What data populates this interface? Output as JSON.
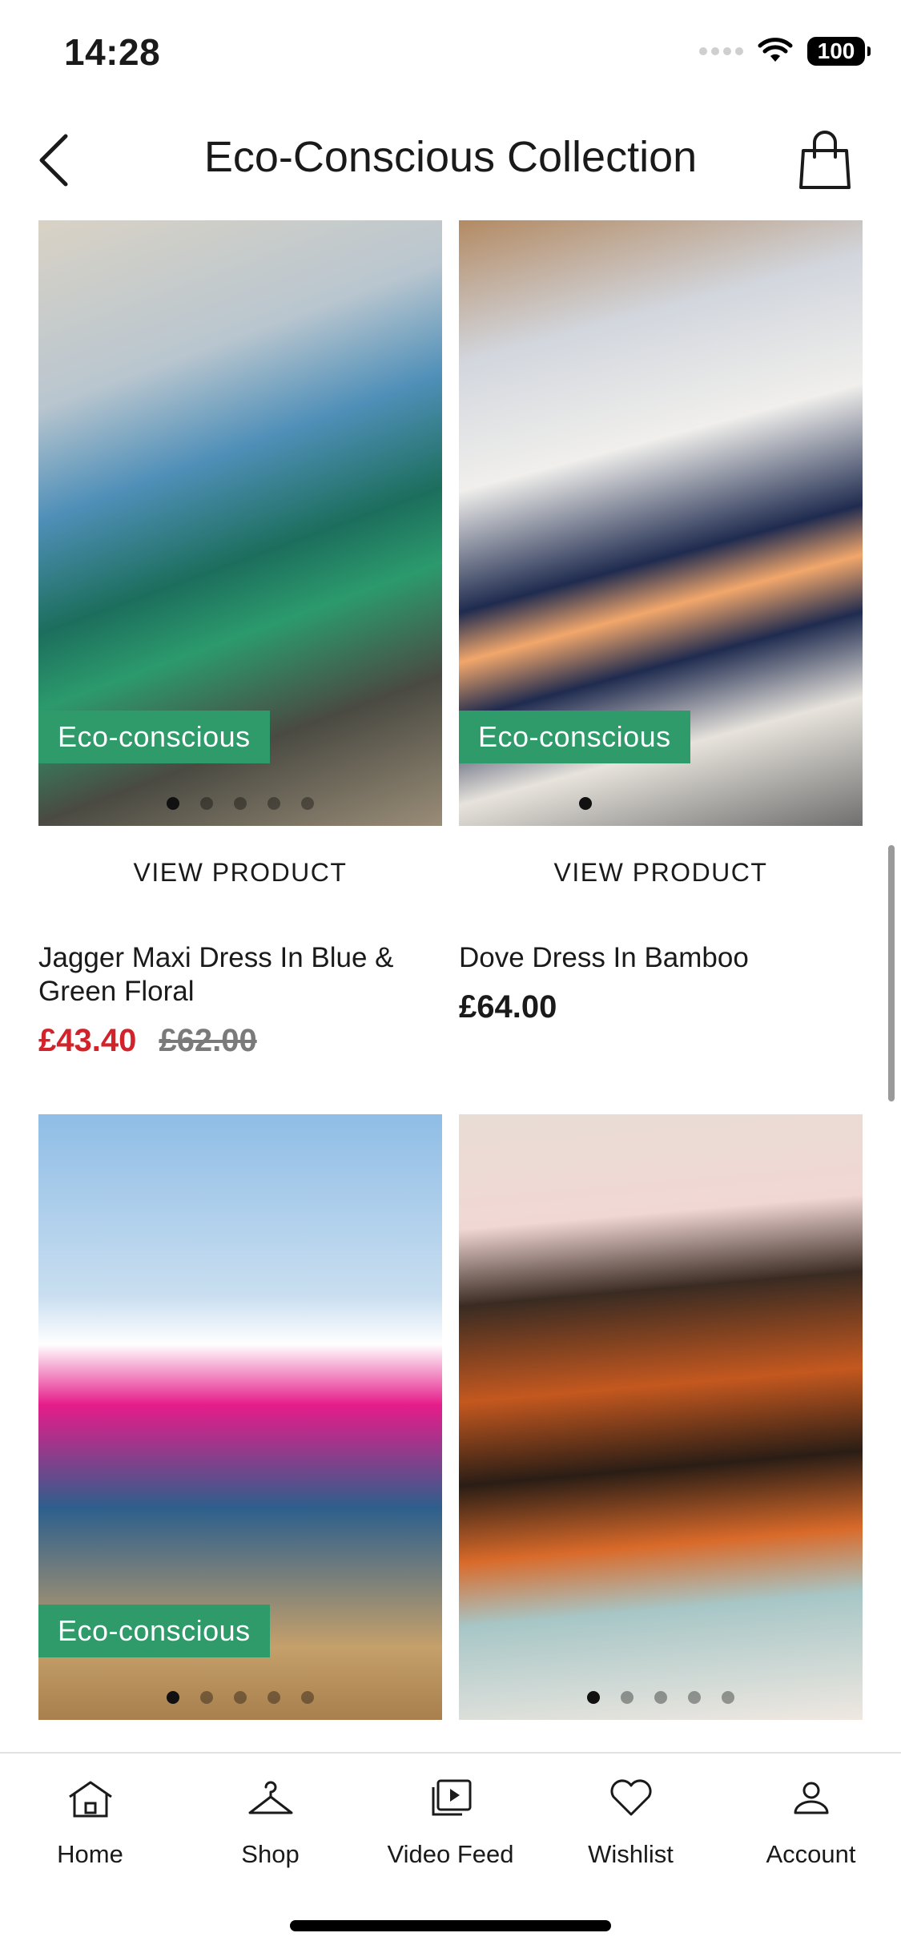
{
  "status_bar": {
    "time": "14:28",
    "battery": "100"
  },
  "header": {
    "title": "Eco-Conscious Collection",
    "back_icon": "chevron-left-icon",
    "bag_icon": "shopping-bag-icon"
  },
  "colors": {
    "eco_badge": "#2f9a6a",
    "sale_price": "#d2232a",
    "text": "#1a1a1a"
  },
  "products": [
    {
      "badge": "Eco-conscious",
      "view_label": "VIEW PRODUCT",
      "name": "Jagger Maxi Dress In Blue & Green Floral",
      "sale_price": "£43.40",
      "was_price": "£62.00"
    },
    {
      "badge": "Eco-conscious",
      "view_label": "VIEW PRODUCT",
      "name": "Dove Dress In Bamboo",
      "price": "£64.00"
    },
    {
      "badge": "Eco-conscious"
    },
    {}
  ],
  "tabs": [
    {
      "label": "Home",
      "icon": "home-icon"
    },
    {
      "label": "Shop",
      "icon": "hanger-icon"
    },
    {
      "label": "Video Feed",
      "icon": "video-feed-icon"
    },
    {
      "label": "Wishlist",
      "icon": "heart-icon"
    },
    {
      "label": "Account",
      "icon": "user-icon"
    }
  ]
}
